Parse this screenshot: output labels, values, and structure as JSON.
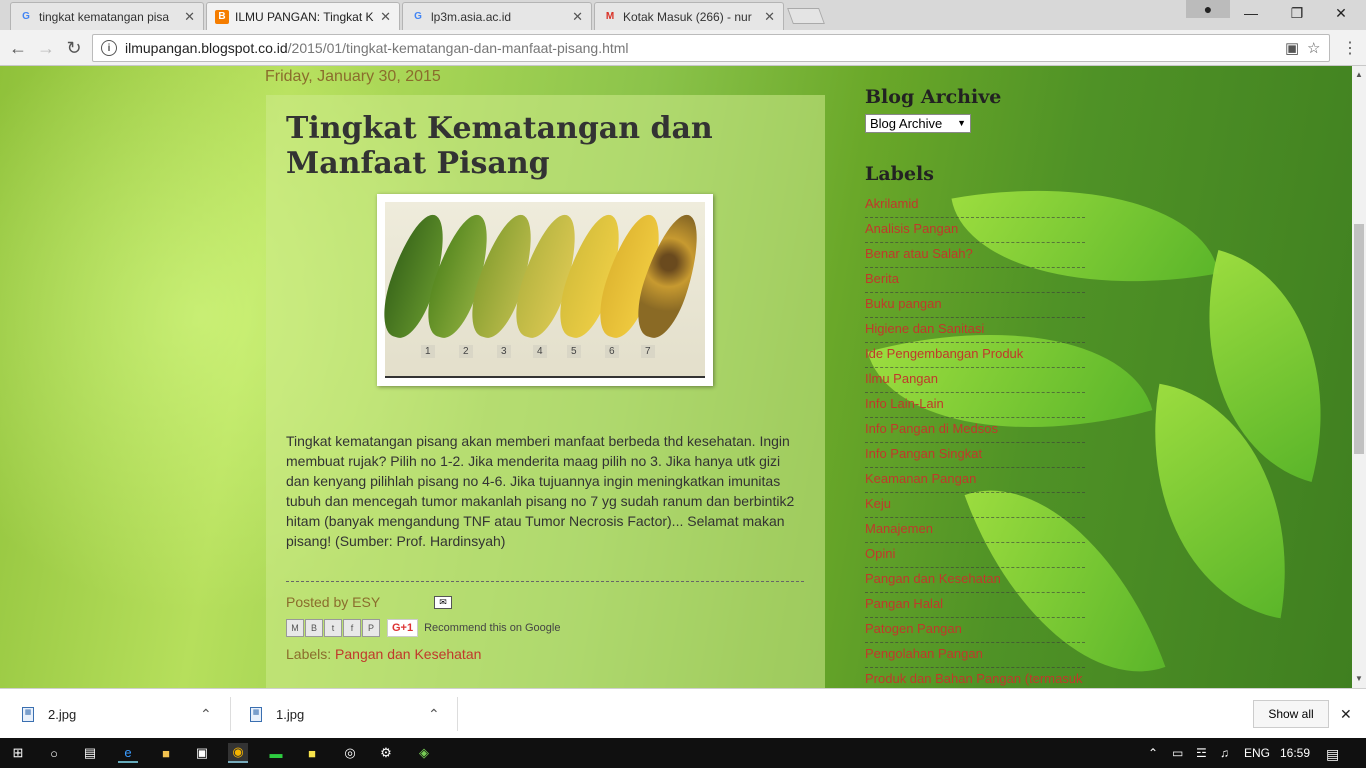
{
  "browser": {
    "tabs": [
      {
        "title": "tingkat kematangan pisa",
        "icon": "google-icon",
        "active": false
      },
      {
        "title": "ILMU PANGAN: Tingkat K",
        "icon": "blogger-icon",
        "active": true
      },
      {
        "title": "lp3m.asia.ac.id",
        "icon": "google-icon",
        "active": false
      },
      {
        "title": "Kotak Masuk (266) - nur",
        "icon": "gmail-icon",
        "active": false
      }
    ],
    "url_host": "ilmupangan.blogspot.co.id",
    "url_path": "/2015/01/tingkat-kematangan-dan-manfaat-pisang.html"
  },
  "post": {
    "date": "Friday, January 30, 2015",
    "title": "Tingkat Kematangan dan Manfaat Pisang",
    "image_numbers": [
      "1",
      "2",
      "3",
      "4",
      "5",
      "6",
      "7"
    ],
    "body": "Tingkat kematangan pisang akan memberi manfaat berbeda thd kesehatan. Ingin membuat rujak? Pilih no 1-2. Jika menderita maag pilih no 3. Jika hanya utk gizi dan kenyang pilihlah pisang no 4-6. Jika tujuannya ingin meningkatkan imunitas tubuh dan mencegah tumor makanlah pisang no 7 yg sudah ranum dan berbintik2 hitam (banyak mengandung TNF atau Tumor Necrosis Factor)... Selamat makan pisang! (Sumber: Prof. Hardinsyah)",
    "posted_by": "Posted by ESY",
    "share_buttons": [
      "M",
      "B",
      "t",
      "f",
      "P"
    ],
    "gplus": "G+1",
    "recommend": "Recommend this on Google",
    "labels_prefix": "Labels: ",
    "labels_value": "Pangan dan Kesehatan"
  },
  "sidebar": {
    "archive_heading": "Blog Archive",
    "archive_select": "Blog Archive",
    "labels_heading": "Labels",
    "labels": [
      "Akrilamid",
      "Analisis Pangan",
      "Benar atau Salah?",
      "Berita",
      "Buku pangan",
      "Higiene dan Sanitasi",
      "Ide Pengembangan Produk",
      "Ilmu Pangan",
      "Info Lain-Lain",
      "Info Pangan di Medsos",
      "Info Pangan Singkat",
      "Keamanan Pangan",
      "Keju",
      "Manajemen",
      "Opini",
      "Pangan dan Kesehatan",
      "Pangan Halal",
      "Patogen Pangan",
      "Pengolahan Pangan",
      "Produk dan Bahan Pangan (termasuk"
    ]
  },
  "downloads": {
    "items": [
      {
        "name": "2.jpg"
      },
      {
        "name": "1.jpg"
      }
    ],
    "show_all": "Show all"
  },
  "taskbar": {
    "lang": "ENG",
    "time": "16:59"
  },
  "colors": {
    "link": "#c0392b",
    "date": "#8a6d2c"
  }
}
